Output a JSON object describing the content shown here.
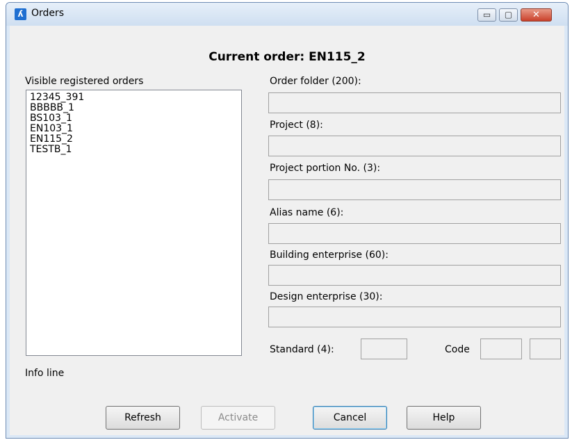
{
  "window": {
    "title": "Orders",
    "app_icon_glyph": "ʎ"
  },
  "window_buttons": {
    "minimize_glyph": "▭",
    "maximize_glyph": "▢",
    "close_glyph": "✕"
  },
  "current_order": "Current order: EN115_2",
  "orders_list": {
    "label": "Visible registered orders",
    "items": [
      "12345_391",
      "BBBBB_1",
      "BS103_1",
      "EN103_1",
      "EN115_2",
      "TESTB_1"
    ]
  },
  "fields": {
    "order_folder": {
      "label": "Order folder (200):",
      "value": ""
    },
    "project": {
      "label": "Project (8):",
      "value": ""
    },
    "project_portion": {
      "label": "Project portion No. (3):",
      "value": ""
    },
    "alias_name": {
      "label": "Alias name (6):",
      "value": ""
    },
    "building_enterprise": {
      "label": "Building enterprise (60):",
      "value": ""
    },
    "design_enterprise": {
      "label": "Design enterprise (30):",
      "value": ""
    },
    "standard": {
      "label": "Standard (4):",
      "value": ""
    },
    "code": {
      "label": "Code",
      "value1": "",
      "value2": ""
    }
  },
  "info_line": "Info line",
  "buttons": {
    "refresh": "Refresh",
    "activate": "Activate",
    "cancel": "Cancel",
    "help": "Help"
  }
}
